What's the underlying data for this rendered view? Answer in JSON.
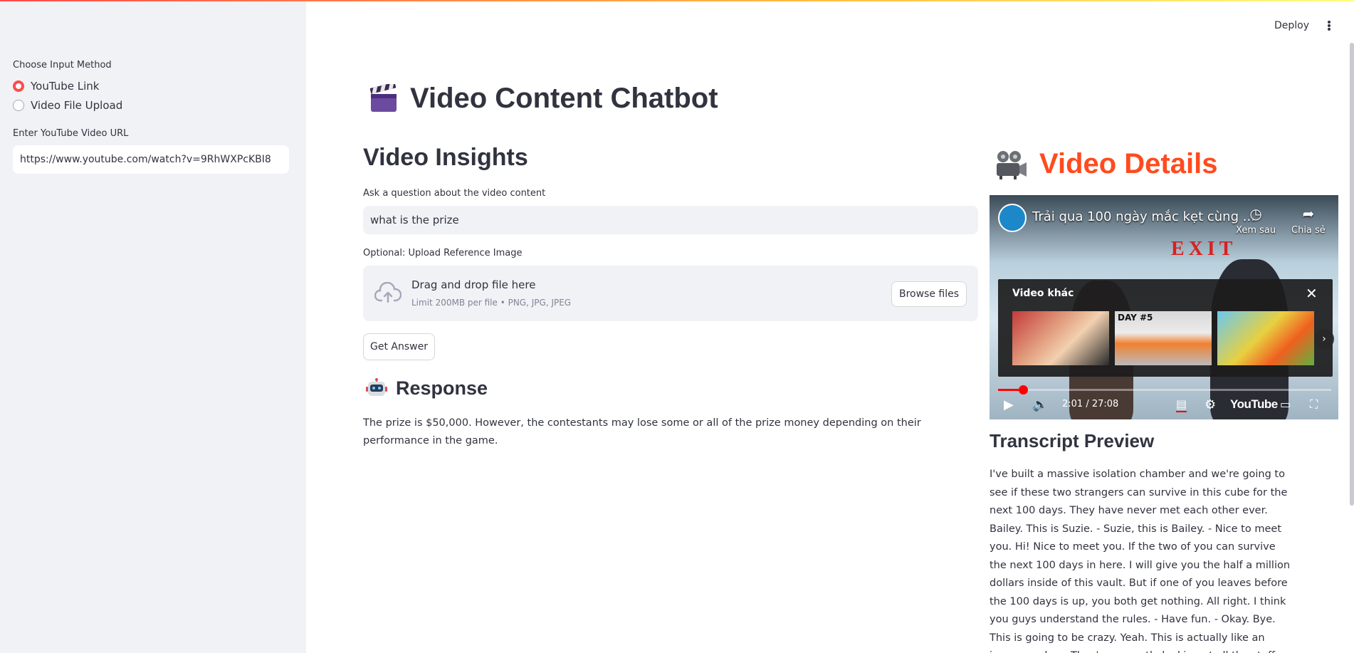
{
  "sidebar": {
    "input_method_label": "Choose Input Method",
    "options": [
      {
        "label": "YouTube Link",
        "selected": true
      },
      {
        "label": "Video File Upload",
        "selected": false
      }
    ],
    "url_label": "Enter YouTube Video URL",
    "url_value": "https://www.youtube.com/watch?v=9RhWXPcKBI8"
  },
  "header": {
    "deploy_label": "Deploy",
    "menu_icon": "kebab-menu-icon"
  },
  "main": {
    "title": "Video Content Chatbot",
    "title_icon": "clapperboard-icon",
    "insights_heading": "Video Insights",
    "question_label": "Ask a question about the video content",
    "question_value": "what is the prize",
    "upload_label": "Optional: Upload Reference Image",
    "upload_main": "Drag and drop file here",
    "upload_sub": "Limit 200MB per file • PNG, JPG, JPEG",
    "browse_label": "Browse files",
    "get_answer_label": "Get Answer",
    "response_heading": "Response",
    "response_icon": "robot-icon",
    "response_text": "The prize is $50,000. However, the contestants may lose some or all of the prize money depending on their performance in the game."
  },
  "details": {
    "heading": "Video Details",
    "heading_icon": "film-projector-icon",
    "accent_color": "#ff4b1f",
    "video": {
      "title": "Trải qua 100 ngày mắc kẹt cùng ...",
      "watch_later": "Xem sau",
      "share": "Chia sẻ",
      "scene_text": "EXIT",
      "more_videos_label": "Video khác",
      "thumb_labels": [
        "",
        "DAY #5",
        ""
      ],
      "time_current": "2:01",
      "time_total": "27:08",
      "time_display": "2:01 / 27:08",
      "progress_fraction": 0.074,
      "logo_text": "YouTube"
    },
    "transcript_heading": "Transcript Preview",
    "transcript_text": "I've built a massive isolation chamber and we're going to see if these two strangers can survive in this cube for the next 100 days. They have never met each other ever. Bailey. This is Suzie. - Suzie, this is Bailey. - Nice to meet you. Hi! Nice to meet you. If the two of you can survive the next 100 days in here. I will give you the half a million dollars inside of this vault. But if one of you leaves before the 100 days is up, you both get nothing. All right. I think you guys understand the rules. - Have fun. - Okay. Bye. This is going to be crazy. Yeah. This is actually like an insane asylum. They're currently looking at all the stuff we put"
  }
}
